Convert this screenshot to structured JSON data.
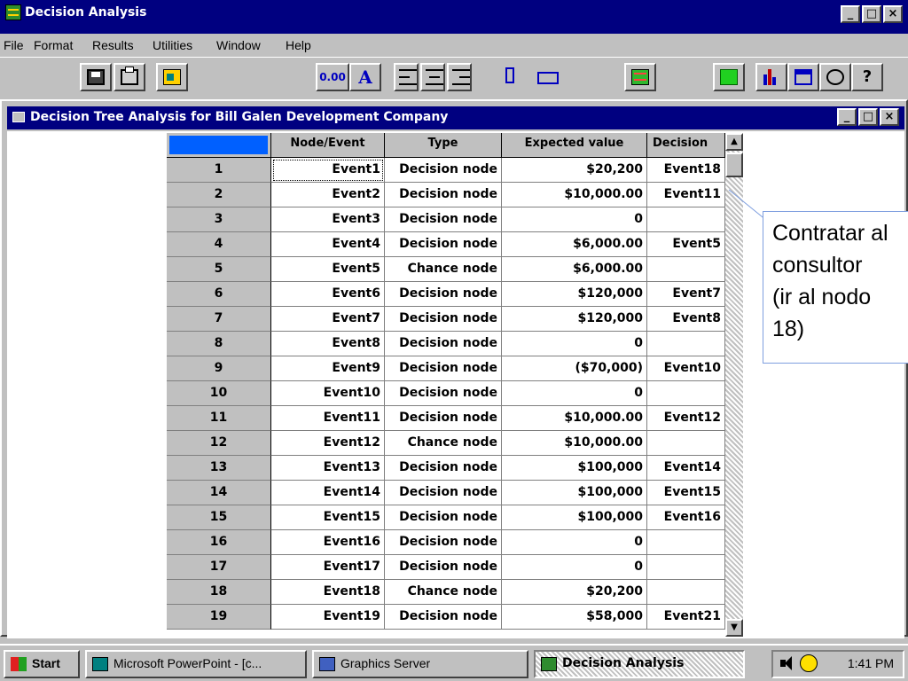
{
  "app": {
    "title": "Decision Analysis",
    "window_buttons": [
      "_",
      "□",
      "×"
    ]
  },
  "menu": {
    "items": [
      "File",
      "Format",
      "Results",
      "Utilities",
      "Window",
      "Help"
    ]
  },
  "toolbar": {
    "buttons": [
      {
        "name": "save-icon"
      },
      {
        "name": "print-icon"
      },
      {
        "name": "exit-door-icon"
      },
      {
        "name": "decimal-format-button",
        "label": "0.00"
      },
      {
        "name": "font-button",
        "label": "A"
      },
      {
        "name": "align-left-icon"
      },
      {
        "name": "align-center-icon"
      },
      {
        "name": "align-right-icon"
      },
      {
        "name": "row-height-icon"
      },
      {
        "name": "column-width-icon"
      },
      {
        "name": "tree-view-icon"
      },
      {
        "name": "grid-view-icon"
      },
      {
        "name": "bar-chart-icon"
      },
      {
        "name": "calculator-icon"
      },
      {
        "name": "clock-icon"
      },
      {
        "name": "help-icon"
      }
    ]
  },
  "child_window": {
    "title": "Decision Tree Analysis for Bill Galen Development Company"
  },
  "table": {
    "columns": [
      "",
      "Node/Event",
      "Type",
      "Expected value",
      "Decision"
    ],
    "rows": [
      [
        "1",
        "Event1",
        "Decision node",
        "$20,200",
        "Event18"
      ],
      [
        "2",
        "Event2",
        "Decision node",
        "$10,000.00",
        "Event11"
      ],
      [
        "3",
        "Event3",
        "Decision node",
        "0",
        ""
      ],
      [
        "4",
        "Event4",
        "Decision node",
        "$6,000.00",
        "Event5"
      ],
      [
        "5",
        "Event5",
        "Chance node",
        "$6,000.00",
        ""
      ],
      [
        "6",
        "Event6",
        "Decision node",
        "$120,000",
        "Event7"
      ],
      [
        "7",
        "Event7",
        "Decision node",
        "$120,000",
        "Event8"
      ],
      [
        "8",
        "Event8",
        "Decision node",
        "0",
        ""
      ],
      [
        "9",
        "Event9",
        "Decision node",
        "($70,000)",
        "Event10"
      ],
      [
        "10",
        "Event10",
        "Decision node",
        "0",
        ""
      ],
      [
        "11",
        "Event11",
        "Decision node",
        "$10,000.00",
        "Event12"
      ],
      [
        "12",
        "Event12",
        "Chance node",
        "$10,000.00",
        ""
      ],
      [
        "13",
        "Event13",
        "Decision node",
        "$100,000",
        "Event14"
      ],
      [
        "14",
        "Event14",
        "Decision node",
        "$100,000",
        "Event15"
      ],
      [
        "15",
        "Event15",
        "Decision node",
        "$100,000",
        "Event16"
      ],
      [
        "16",
        "Event16",
        "Decision node",
        "0",
        ""
      ],
      [
        "17",
        "Event17",
        "Decision node",
        "0",
        ""
      ],
      [
        "18",
        "Event18",
        "Chance node",
        "$20,200",
        ""
      ],
      [
        "19",
        "Event19",
        "Decision node",
        "$58,000",
        "Event21"
      ]
    ]
  },
  "callout": {
    "text": "Contratar al\nconsultor\n(ir al nodo\n18)"
  },
  "taskbar": {
    "start_label": "Start",
    "tasks": [
      "Microsoft PowerPoint - [c...",
      "Graphics Server",
      "Decision Analysis"
    ],
    "clock": "1:41 PM"
  }
}
